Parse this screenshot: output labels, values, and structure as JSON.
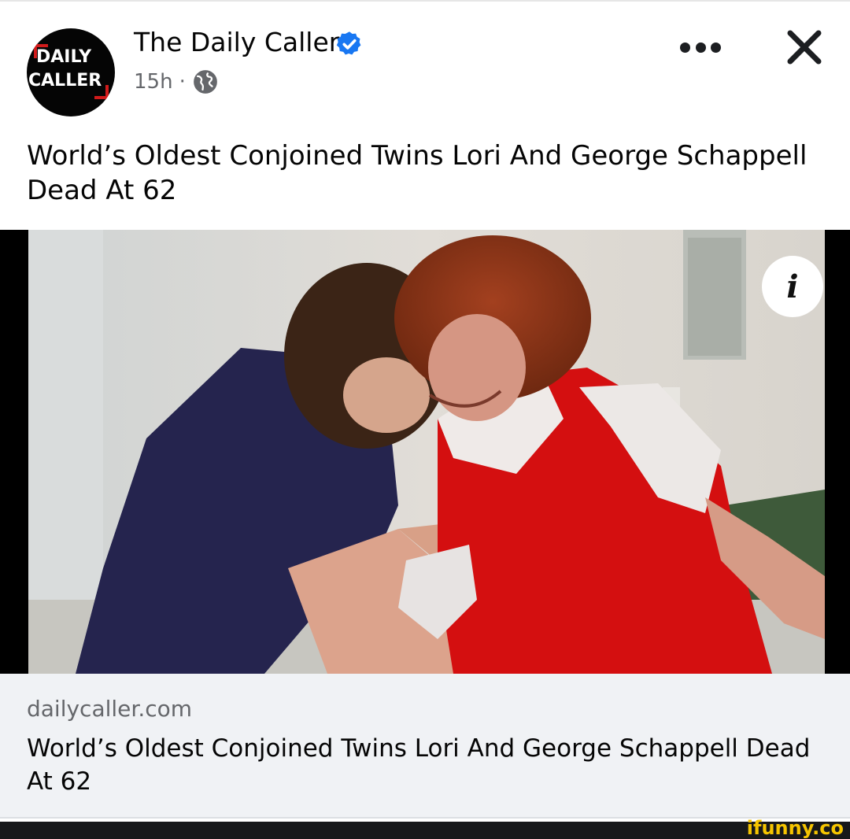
{
  "post": {
    "page_name": "The Daily Caller",
    "time": "15h",
    "separator": "·",
    "text": "World’s Oldest Conjoined Twins Lori And George Schappell Dead At 62"
  },
  "avatar": {
    "line1": "DAILY",
    "line2": "CALLER"
  },
  "icons": {
    "verified": "verified-badge-icon",
    "privacy": "globe-icon",
    "more": "more-options-icon",
    "close": "close-icon",
    "info": "info-icon"
  },
  "link": {
    "domain": "dailycaller.com",
    "title": "World’s Oldest Conjoined Twins Lori And George Schappell Dead At 62"
  },
  "info_glyph": "i",
  "watermark": "ifunny.co",
  "colors": {
    "verified_blue": "#1877f2",
    "secondary_text": "#65676b",
    "link_card_bg": "#f0f2f5",
    "brand_red": "#d11b1b",
    "watermark_yellow": "#f5c400"
  }
}
